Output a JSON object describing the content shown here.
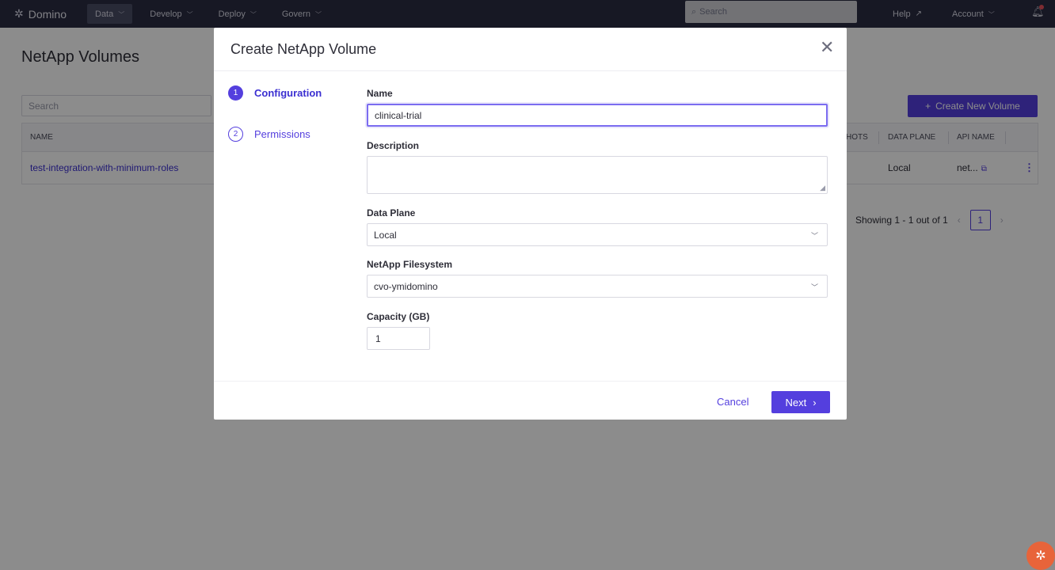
{
  "nav": {
    "brand": "Domino",
    "items": [
      {
        "label": "Data",
        "active": true
      },
      {
        "label": "Develop",
        "active": false
      },
      {
        "label": "Deploy",
        "active": false
      },
      {
        "label": "Govern",
        "active": false
      }
    ],
    "search_placeholder": "Search",
    "help": "Help",
    "account": "Account"
  },
  "page": {
    "title": "NetApp Volumes",
    "search_placeholder": "Search",
    "create_button": "Create New Volume",
    "table": {
      "columns": [
        "NAME",
        "HOTS",
        "DATA PLANE",
        "API NAME"
      ],
      "rows": [
        {
          "name": "test-integration-with-minimum-roles",
          "data_plane": "Local",
          "api_name": "net..."
        }
      ]
    },
    "pagination": {
      "summary": "Showing 1 - 1 out of 1",
      "current_page": "1"
    }
  },
  "modal": {
    "title": "Create NetApp Volume",
    "steps": [
      {
        "number": "1",
        "label": "Configuration"
      },
      {
        "number": "2",
        "label": "Permissions"
      }
    ],
    "fields": {
      "name": {
        "label": "Name",
        "value": "clinical-trial"
      },
      "description": {
        "label": "Description",
        "value": ""
      },
      "data_plane": {
        "label": "Data Plane",
        "value": "Local"
      },
      "filesystem": {
        "label": "NetApp Filesystem",
        "value": "cvo-ymidomino"
      },
      "capacity": {
        "label": "Capacity (GB)",
        "value": "1"
      }
    },
    "cancel": "Cancel",
    "next": "Next"
  },
  "colors": {
    "primary": "#543fde",
    "nav_bg": "#2b2d42",
    "logo": "#e8643a"
  }
}
